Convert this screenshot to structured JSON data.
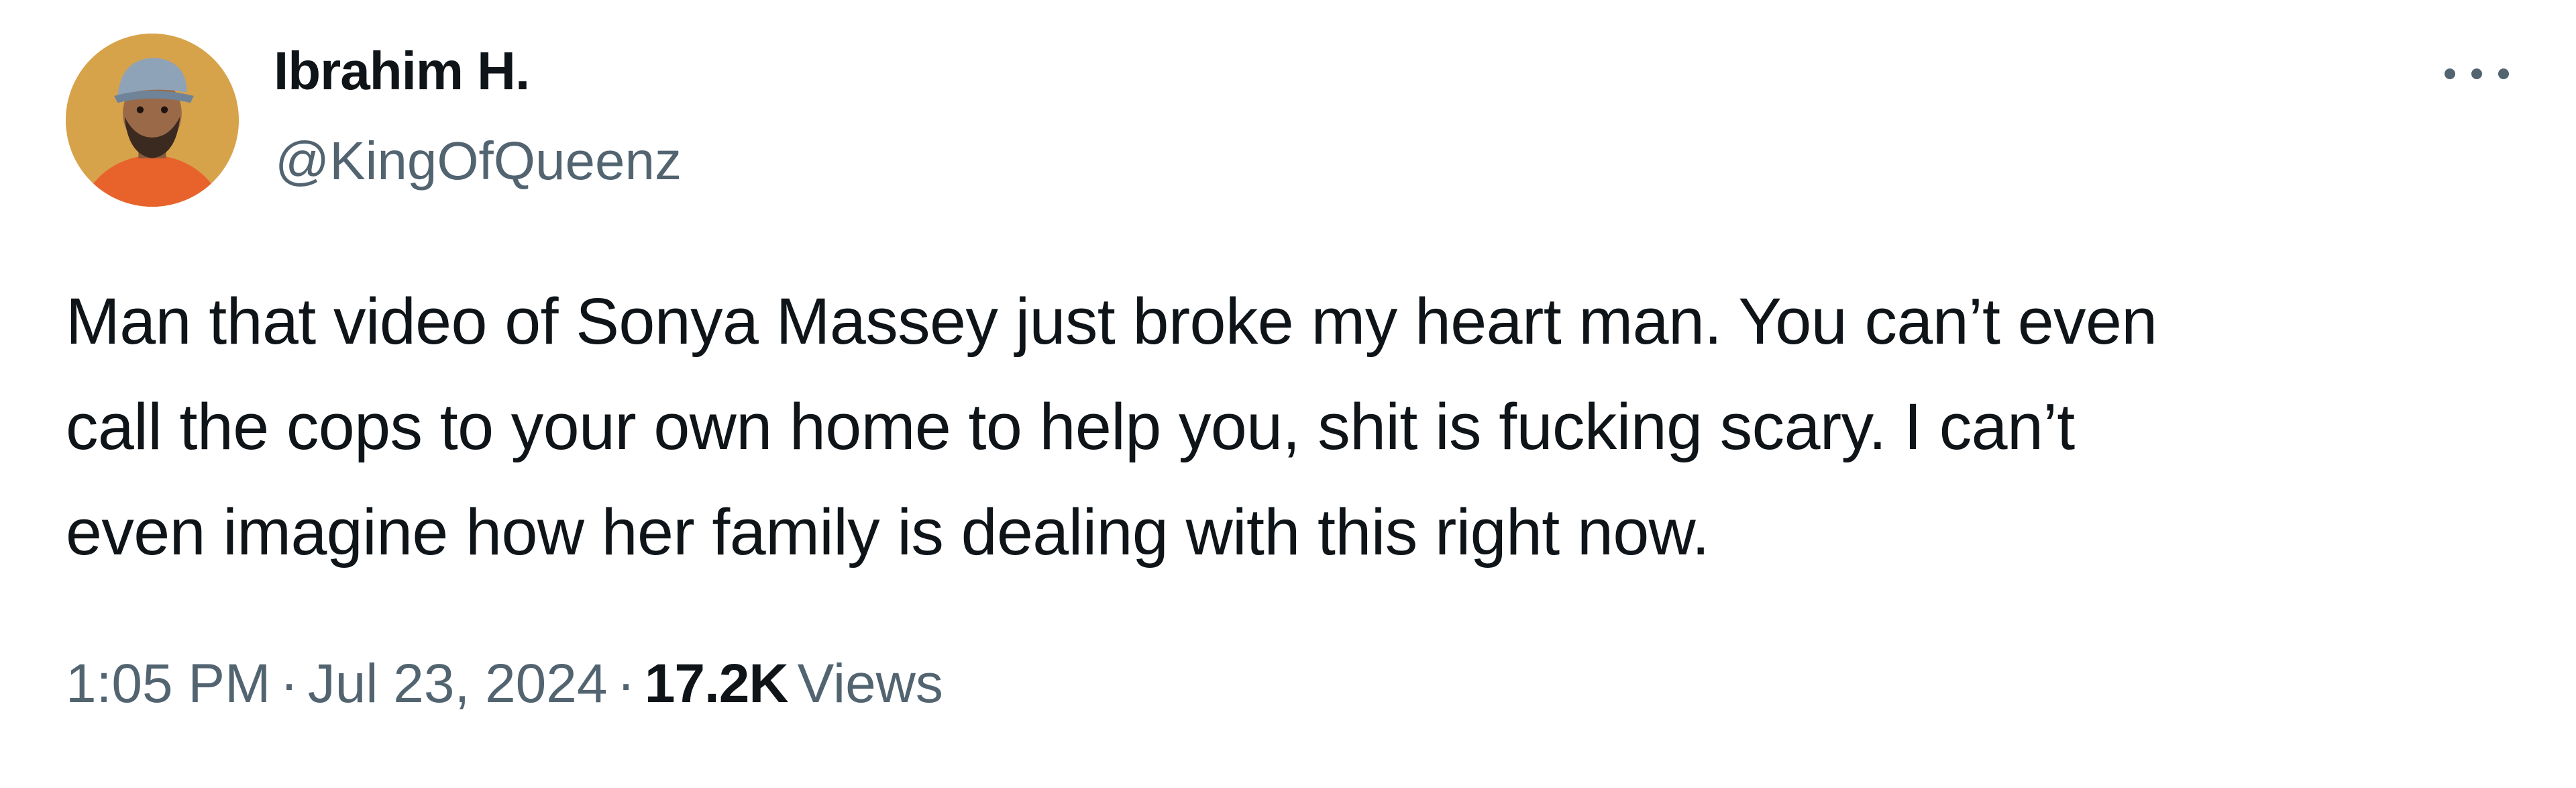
{
  "author": {
    "name": "Ibrahim H.",
    "handle": "@KingOfQueenz",
    "avatar_icon": "profile-photo"
  },
  "more_icon": "ellipsis-icon",
  "tweet": {
    "lines": [
      "Man that video of Sonya Massey just broke my heart man. You can’t even",
      "call the cops to your own home to help you, shit is fucking scary. I can’t",
      "even imagine how her family is dealing with this right now."
    ]
  },
  "meta": {
    "time": "1:05 PM",
    "separator": "·",
    "date": "Jul 23, 2024",
    "views_count": "17.2K",
    "views_label": "Views"
  },
  "colors": {
    "text_primary": "#0f1419",
    "text_secondary": "#536471",
    "background": "#ffffff"
  }
}
